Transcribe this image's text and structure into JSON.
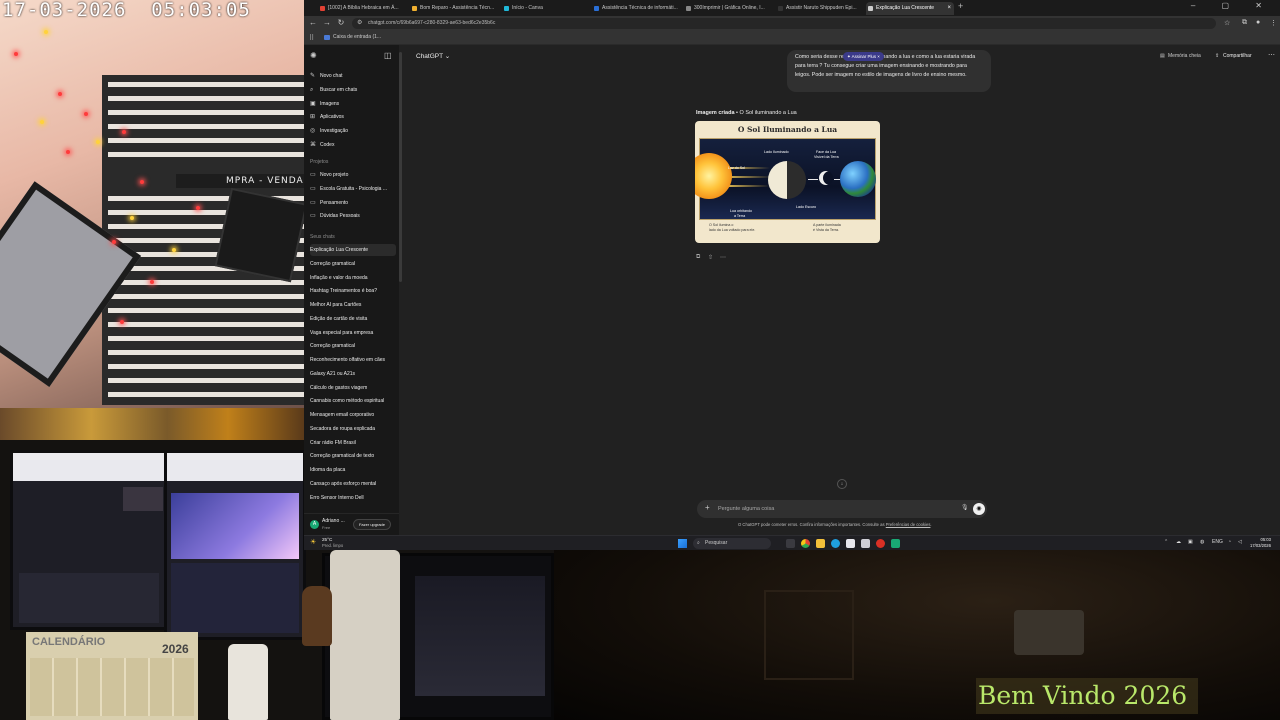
{
  "overlay": {
    "timestamp": "17-03-2026  05:03:05",
    "shop_sign": "MPRA - VENDA",
    "calendar_title": "CALENDÁRIO",
    "calendar_year": "2026",
    "welcome": "Bem Vindo 2026"
  },
  "browser": {
    "tabs": [
      {
        "label": "[1002] A Bíblia Hebraica em Á...",
        "color": "#e34133",
        "active": false
      },
      {
        "label": "Bom Reparo - Assistência Técn...",
        "color": "#f0b030",
        "active": false
      },
      {
        "label": "Início - Canva",
        "color": "#20b8d8",
        "active": false
      },
      {
        "label": "Assistência Técnica de informáti...",
        "color": "#2a6fd6",
        "active": false
      },
      {
        "label": "300Imprimir | Gráfica Online, I...",
        "color": "#888888",
        "active": false
      },
      {
        "label": "Assistir Naruto Shippuden Epi...",
        "color": "#333333",
        "active": false
      },
      {
        "label": "Explicação Lua Crescente",
        "color": "#cccccc",
        "active": true
      }
    ],
    "url": "chatgpt.com/c/69b6a697-c280-8329-ae63-bed6c2e35b6c",
    "bookmark": "Caixa de entrada (1..."
  },
  "sidebar": {
    "nav": [
      {
        "label": "Novo chat",
        "icon": "✎"
      },
      {
        "label": "Buscar em chats",
        "icon": "⌕"
      },
      {
        "label": "Imagens",
        "icon": "▣"
      },
      {
        "label": "Aplicativos",
        "icon": "⊞"
      },
      {
        "label": "Investigação",
        "icon": "◎"
      },
      {
        "label": "Codex",
        "icon": "⌘"
      }
    ],
    "projects_title": "Projetos",
    "projects": [
      {
        "label": "Novo projeto",
        "icon": "▭"
      },
      {
        "label": "Escola Gratuita - Psicologia ...",
        "icon": "▭"
      },
      {
        "label": "Pensamento",
        "icon": "▭"
      },
      {
        "label": "Dúvidas Pessoais",
        "icon": "▭"
      }
    ],
    "chats_title": "Seus chats",
    "chats": [
      "Explicação Lua Crescente",
      "Correção gramatical",
      "Inflação e valor da moeda",
      "Hashtag Treinamentos é boa?",
      "Melhor AI para Cartões",
      "Edição de cartão de visita",
      "Vaga especial para empresa",
      "Correção gramatical",
      "Reconhecimento olfativo em cães",
      "Galaxy A21 ou A21s",
      "Cálculo de gastos viagem",
      "Cannabis como método espiritual",
      "Mensagem email corporativo",
      "Secadora de roupa explicada",
      "Criar rádio FM Brasil",
      "Correção gramatical de texto",
      "Idioma da placa",
      "Cansaço após esforço mental",
      "Erro Sensor Interno Dell"
    ],
    "user_name": "Adriano ...",
    "user_plan": "Free",
    "upgrade": "Fazer upgrade",
    "avatar_initial": "A"
  },
  "main": {
    "model": "ChatGPT ⌄",
    "memory": "Memória cheia",
    "share": "Compartilhar",
    "plus_badge": "✦ Assinar Plus ×",
    "user_message": "Como seria desse retrato do sol iluminando a lua e como a lua estaria virada para terra ? Tu consegue criar uma imagem ensinando e mostrando para leigos. Pode ser imagem no estilo de imagens de livro de ensino mesmo.",
    "caption_bold": "Imagem criada",
    "caption_rest": " • O Sol iluminando a Lua",
    "image": {
      "title": "O Sol Iluminando a Lua",
      "label_sun": "Luz do Sol",
      "label_lit": "Lado Iluminado",
      "label_face_1": "Face da Lua",
      "label_face_2": "Visível da Terra",
      "label_dark": "Lado Escuro",
      "label_orbit_1": "Lua orbitando",
      "label_orbit_2": "a Terra",
      "foot_left_1": "O Sol ilumina o",
      "foot_left_2": "lado da Lua voltado para ele.",
      "foot_right_1": "A parte iluminada",
      "foot_right_2": "é Vista da Terra."
    },
    "composer_placeholder": "Pergunte alguma coisa",
    "disclaimer": "O ChatGPT pode cometer erros. Confira informações importantes. Consulte as ",
    "disclaimer_link": "Preferências de cookies",
    "disclaimer_end": "."
  },
  "taskbar": {
    "temp": "25°C",
    "weather": "Pred. limpo",
    "search": "Pesquisar",
    "lang": "ENG",
    "time": "05:03",
    "date": "17/03/2026"
  }
}
